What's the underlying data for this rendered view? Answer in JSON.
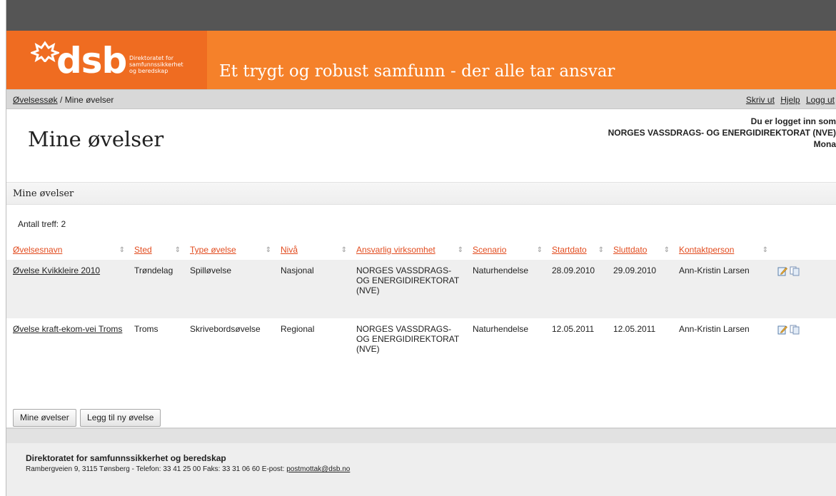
{
  "brand": {
    "logo_text": "dsb",
    "logo_sub": [
      "Direktoratet for",
      "samfunnssikkerhet",
      "og beredskap"
    ],
    "slogan": "Et trygt og robust samfunn - der alle tar ansvar",
    "colors": {
      "orange": "#f5812a",
      "dark_orange": "#ef6c21",
      "link_red": "#e24c1f"
    }
  },
  "breadcrumb": {
    "items": [
      "Øvelsessøk",
      "Mine øvelser"
    ],
    "separator": "/"
  },
  "toplinks": [
    "Skriv ut",
    "Hjelp",
    "Logg ut"
  ],
  "page_title": "Mine øvelser",
  "login": {
    "line1": "Du er logget inn som",
    "line2": "NORGES VASSDRAGS- OG ENERGIDIREKTORAT (NVE)",
    "line3": "Mona"
  },
  "section_title": "Mine øvelser",
  "result_count": "Antall treff: 2",
  "table": {
    "columns": [
      "Øvelsesnavn",
      "Sted",
      "Type øvelse",
      "Nivå",
      "Ansvarlig virksomhet",
      "Scenario",
      "Startdato",
      "Sluttdato",
      "Kontaktperson"
    ],
    "rows": [
      {
        "name": "Øvelse Kvikkleire 2010",
        "place": "Trøndelag",
        "type": "Spilløvelse",
        "level": "Nasjonal",
        "org": "NORGES VASSDRAGS- OG ENERGIDIREKTORAT (NVE)",
        "scenario": "Naturhendelse",
        "start": "28.09.2010",
        "end": "29.09.2010",
        "contact": "Ann-Kristin Larsen"
      },
      {
        "name": "Øvelse kraft-ekom-vei Troms",
        "place": "Troms",
        "type": "Skrivebordsøvelse",
        "level": "Regional",
        "org": "NORGES VASSDRAGS- OG ENERGIDIREKTORAT (NVE)",
        "scenario": "Naturhendelse",
        "start": "12.05.2011",
        "end": "12.05.2011",
        "contact": "Ann-Kristin Larsen"
      }
    ],
    "row_icons": [
      "edit-icon",
      "copy-icon"
    ]
  },
  "buttons": {
    "mine": "Mine øvelser",
    "add": "Legg til ny øvelse"
  },
  "footer": {
    "title": "Direktoratet for samfunnssikkerhet og beredskap",
    "address": "Rambergveien 9, 3115 Tønsberg - Telefon: 33 41 25 00 Faks: 33 31 06 60 E-post: ",
    "email": "postmottak@dsb.no"
  }
}
